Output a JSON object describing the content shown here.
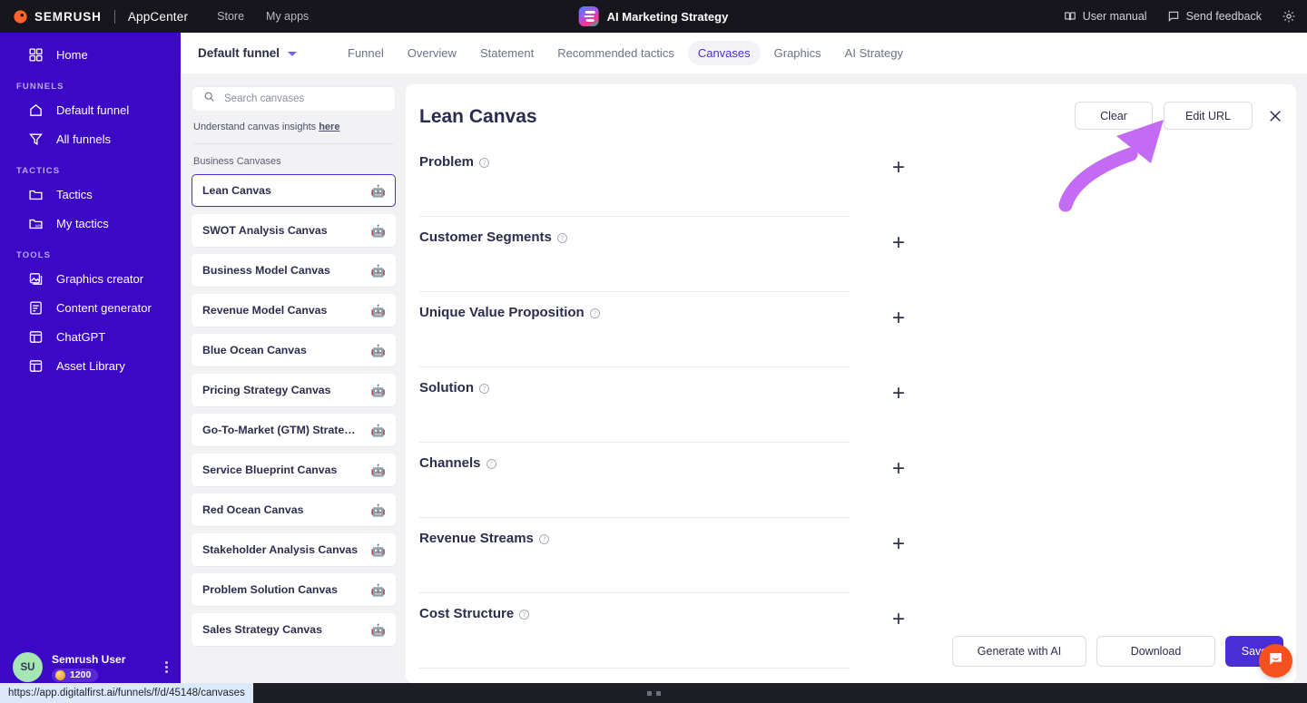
{
  "topbar": {
    "brand": "SEMRUSH",
    "brand_sub": "AppCenter",
    "nav": [
      {
        "label": "Store"
      },
      {
        "label": "My apps"
      }
    ],
    "app_title": "AI Marketing Strategy",
    "right": [
      {
        "label": "User manual",
        "icon": "book-icon"
      },
      {
        "label": "Send feedback",
        "icon": "chat-icon"
      }
    ],
    "settings_icon": "gear-icon",
    "background": "#16161c"
  },
  "sidebar": {
    "background": "#3d07c6",
    "top_items": [
      {
        "label": "Home",
        "icon": "grid-icon"
      }
    ],
    "groups": [
      {
        "title": "FUNNELS",
        "items": [
          {
            "label": "Default funnel",
            "icon": "home-icon"
          },
          {
            "label": "All funnels",
            "icon": "funnel-icon"
          }
        ]
      },
      {
        "title": "TACTICS",
        "items": [
          {
            "label": "Tactics",
            "icon": "folder-icon"
          },
          {
            "label": "My tactics",
            "icon": "folder-my-icon"
          }
        ]
      },
      {
        "title": "TOOLS",
        "items": [
          {
            "label": "Graphics creator",
            "icon": "image-icon"
          },
          {
            "label": "Content generator",
            "icon": "document-icon"
          },
          {
            "label": "ChatGPT",
            "icon": "layout-icon"
          },
          {
            "label": "Asset Library",
            "icon": "layout-icon"
          }
        ]
      }
    ],
    "user": {
      "initials": "SU",
      "name": "Semrush User",
      "credits": "1200",
      "menu_icon": "kebab-menu-icon"
    }
  },
  "subnav": {
    "funnel_selector": "Default funnel",
    "tabs": [
      {
        "label": "Funnel",
        "active": false
      },
      {
        "label": "Overview",
        "active": false
      },
      {
        "label": "Statement",
        "active": false
      },
      {
        "label": "Recommended tactics",
        "active": false
      },
      {
        "label": "Canvases",
        "active": true
      },
      {
        "label": "Graphics",
        "active": false
      },
      {
        "label": "AI Strategy",
        "active": false
      }
    ]
  },
  "list_panel": {
    "search": {
      "placeholder": "Search canvases",
      "value": "",
      "icon": "search-icon"
    },
    "insight_text": "Understand canvas insights",
    "insight_link": "here",
    "group_title": "Business Canvases",
    "items": [
      {
        "label": "Lean Canvas",
        "selected": true,
        "icon": "robot-icon"
      },
      {
        "label": "SWOT Analysis Canvas",
        "selected": false,
        "icon": "robot-icon"
      },
      {
        "label": "Business Model Canvas",
        "selected": false,
        "icon": "robot-icon"
      },
      {
        "label": "Revenue Model Canvas",
        "selected": false,
        "icon": "robot-icon"
      },
      {
        "label": "Blue Ocean Canvas",
        "selected": false,
        "icon": "robot-icon"
      },
      {
        "label": "Pricing Strategy Canvas",
        "selected": false,
        "icon": "robot-icon"
      },
      {
        "label": "Go-To-Market (GTM) Strateg…",
        "selected": false,
        "icon": "robot-icon"
      },
      {
        "label": "Service Blueprint Canvas",
        "selected": false,
        "icon": "robot-icon"
      },
      {
        "label": "Red Ocean Canvas",
        "selected": false,
        "icon": "robot-icon"
      },
      {
        "label": "Stakeholder Analysis Canvas",
        "selected": false,
        "icon": "robot-icon"
      },
      {
        "label": "Problem Solution Canvas",
        "selected": false,
        "icon": "robot-icon"
      },
      {
        "label": "Sales Strategy Canvas",
        "selected": false,
        "icon": "robot-icon"
      }
    ]
  },
  "canvas": {
    "title": "Lean Canvas",
    "clear_label": "Clear",
    "edit_url_label": "Edit URL",
    "close_icon": "close-icon",
    "fields": [
      {
        "label": "Problem",
        "value": "",
        "help_icon": "help-icon",
        "add_icon": "plus-icon"
      },
      {
        "label": "Customer Segments",
        "value": "",
        "help_icon": "help-icon",
        "add_icon": "plus-icon"
      },
      {
        "label": "Unique Value Proposition",
        "value": "",
        "help_icon": "help-icon",
        "add_icon": "plus-icon"
      },
      {
        "label": "Solution",
        "value": "",
        "help_icon": "help-icon",
        "add_icon": "plus-icon"
      },
      {
        "label": "Channels",
        "value": "",
        "help_icon": "help-icon",
        "add_icon": "plus-icon"
      },
      {
        "label": "Revenue Streams",
        "value": "",
        "help_icon": "help-icon",
        "add_icon": "plus-icon"
      },
      {
        "label": "Cost Structure",
        "value": "",
        "help_icon": "help-icon",
        "add_icon": "plus-icon"
      }
    ],
    "generate_label": "Generate with AI",
    "download_label": "Download",
    "save_label": "Save",
    "save_color": "#4b2fd6"
  },
  "annotation": {
    "arrow_color": "#c36bf5",
    "points_at": "Edit URL"
  },
  "chat_widget": {
    "icon": "chat-bubble-icon",
    "color": "#f4511e"
  },
  "status_bar": {
    "url": "https://app.digitalfirst.ai/funnels/f/d/45148/canvases"
  }
}
